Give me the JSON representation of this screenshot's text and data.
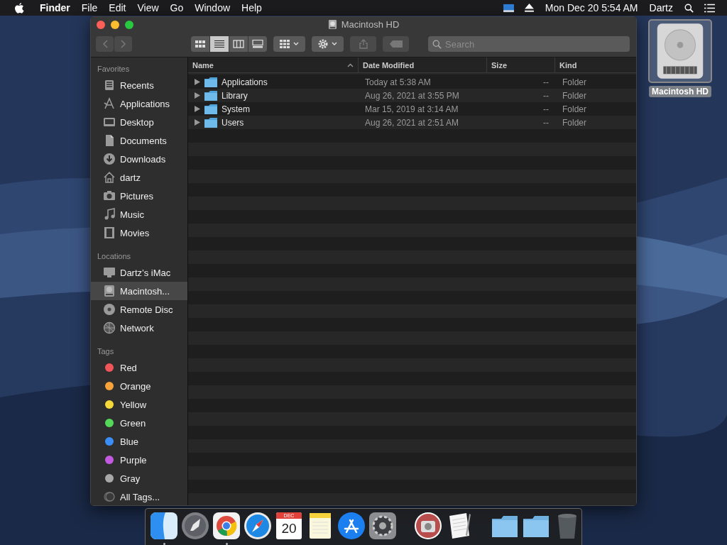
{
  "menubar": {
    "app": "Finder",
    "menus": [
      "File",
      "Edit",
      "View",
      "Go",
      "Window",
      "Help"
    ],
    "clock": "Mon Dec 20  5:54 AM",
    "user": "Dartz"
  },
  "window": {
    "title": "Macintosh HD",
    "view_modes": [
      {
        "kind": "icons",
        "selected": false
      },
      {
        "kind": "list",
        "selected": true
      },
      {
        "kind": "columns",
        "selected": false
      },
      {
        "kind": "gallery",
        "selected": false
      }
    ],
    "search": {
      "placeholder": "Search"
    },
    "sidebar": [
      {
        "heading": "Favorites",
        "items": [
          {
            "label": "Recents",
            "kind": "recents",
            "selected": false
          },
          {
            "label": "Applications",
            "kind": "applications",
            "selected": false
          },
          {
            "label": "Desktop",
            "kind": "desktop",
            "selected": false
          },
          {
            "label": "Documents",
            "kind": "documents",
            "selected": false
          },
          {
            "label": "Downloads",
            "kind": "downloads",
            "selected": false
          },
          {
            "label": "dartz",
            "kind": "home",
            "selected": false
          },
          {
            "label": "Pictures",
            "kind": "pictures",
            "selected": false
          },
          {
            "label": "Music",
            "kind": "music",
            "selected": false
          },
          {
            "label": "Movies",
            "kind": "movies",
            "selected": false
          }
        ]
      },
      {
        "heading": "Locations",
        "items": [
          {
            "label": "Dartz’s iMac",
            "kind": "computer",
            "selected": false
          },
          {
            "label": "Macintosh...",
            "kind": "drive",
            "selected": true
          },
          {
            "label": "Remote Disc",
            "kind": "disc",
            "selected": false
          },
          {
            "label": "Network",
            "kind": "network",
            "selected": false
          }
        ]
      },
      {
        "heading": "Tags",
        "items": [
          {
            "label": "Red",
            "kind": "tag",
            "color": "#f0555a",
            "selected": false
          },
          {
            "label": "Orange",
            "kind": "tag",
            "color": "#f5a33a",
            "selected": false
          },
          {
            "label": "Yellow",
            "kind": "tag",
            "color": "#f5d93a",
            "selected": false
          },
          {
            "label": "Green",
            "kind": "tag",
            "color": "#55d85a",
            "selected": false
          },
          {
            "label": "Blue",
            "kind": "tag",
            "color": "#3a8ef5",
            "selected": false
          },
          {
            "label": "Purple",
            "kind": "tag",
            "color": "#c25ae0",
            "selected": false
          },
          {
            "label": "Gray",
            "kind": "tag",
            "color": "#a8a8a8",
            "selected": false
          },
          {
            "label": "All Tags...",
            "kind": "alltags",
            "selected": false
          }
        ]
      }
    ],
    "columns": [
      {
        "label": "Name",
        "sorted": true
      },
      {
        "label": "Date Modified",
        "sorted": false
      },
      {
        "label": "Size",
        "sorted": false
      },
      {
        "label": "Kind",
        "sorted": false
      }
    ],
    "rows": [
      {
        "name": "Applications",
        "date": "Today at 5:38 AM",
        "size": "--",
        "kind": "Folder",
        "selected": false
      },
      {
        "name": "Library",
        "date": "Aug 26, 2021 at 3:55 PM",
        "size": "--",
        "kind": "Folder",
        "selected": false
      },
      {
        "name": "System",
        "date": "Mar 15, 2019 at 3:14 AM",
        "size": "--",
        "kind": "Folder",
        "selected": false
      },
      {
        "name": "Users",
        "date": "Aug 26, 2021 at 2:51 AM",
        "size": "--",
        "kind": "Folder",
        "selected": false
      }
    ]
  },
  "desktop_icon": {
    "label": "Macintosh HD",
    "selected": true
  },
  "dock": [
    {
      "kind": "finder",
      "running": true
    },
    {
      "kind": "rocket",
      "running": false
    },
    {
      "kind": "chrome",
      "running": true
    },
    {
      "kind": "compass",
      "running": false
    },
    {
      "kind": "calendar",
      "month": "DEC",
      "day": "20",
      "running": false
    },
    {
      "kind": "notes",
      "running": false
    },
    {
      "kind": "appstore",
      "running": false
    },
    {
      "kind": "gear",
      "running": false
    },
    {
      "kind": "separator"
    },
    {
      "kind": "camera",
      "running": false
    },
    {
      "kind": "paper",
      "running": false
    },
    {
      "kind": "separator"
    },
    {
      "kind": "folder",
      "running": false
    },
    {
      "kind": "folder",
      "running": false
    },
    {
      "kind": "trash",
      "running": false
    }
  ]
}
